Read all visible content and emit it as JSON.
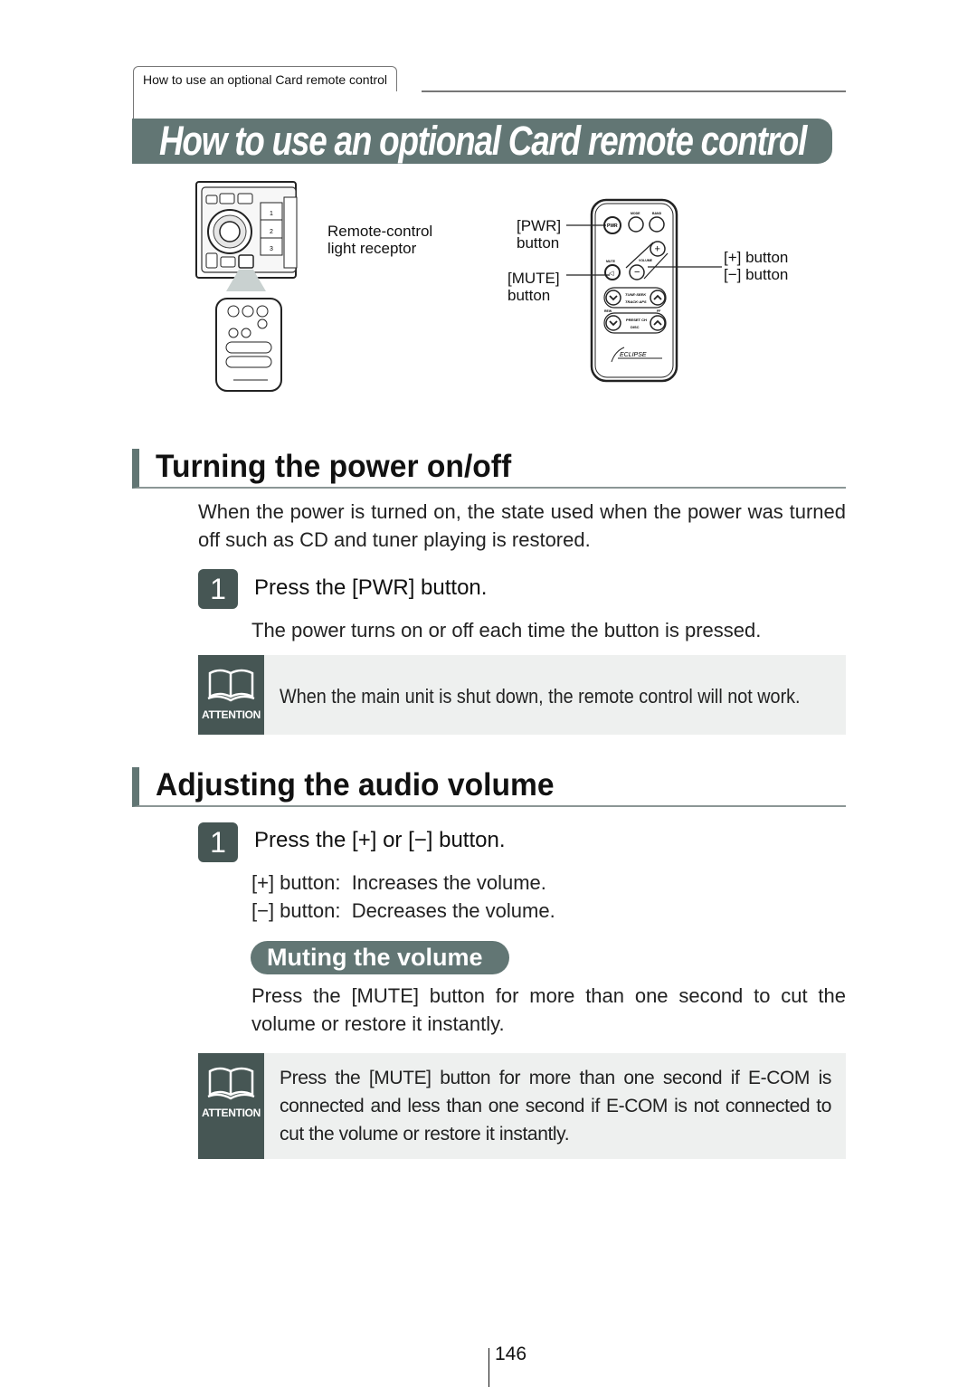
{
  "header": {
    "tab_label": "How to use an optional Card remote control",
    "banner_title": "How to use an optional Card remote control"
  },
  "diagram": {
    "receptor_label_line1": "Remote-control",
    "receptor_label_line2": "light receptor",
    "pwr_label_line1": "[PWR]",
    "pwr_label_line2": "button",
    "mute_label_line1": "[MUTE]",
    "mute_label_line2": "button",
    "plus_label": "[+] button",
    "minus_label": "[−] button",
    "remote_keys": {
      "pwr": "PWR",
      "mode": "MODE",
      "band": "BAND",
      "mute": "MUTE",
      "volume": "VOLUME",
      "tune_seek": "TUNE·SEEK",
      "track_aps": "TRACK·APS",
      "preset_ch": "PRESET CH",
      "disc": "DISC",
      "rew": "REW",
      "ff": "FF",
      "brand": "ECLIPSE"
    }
  },
  "section_power": {
    "title": "Turning the power on/off",
    "intro": "When the power is turned on, the state used when the power was turned off such as CD and tuner playing is restored.",
    "step_number": "1",
    "step_text": "Press the [PWR] button.",
    "step_detail": "The power turns on or off each time the button is pressed.",
    "attention_label": "ATTENTION",
    "attention_text": "When the main unit is shut down, the remote control will not work."
  },
  "section_volume": {
    "title": "Adjusting the audio volume",
    "step_number": "1",
    "step_text": "Press the [+] or [−] button.",
    "plus_desc": "[+] button:  Increases the volume.",
    "minus_desc": "[−] button:  Decreases the volume.",
    "mute_heading": "Muting the volume",
    "mute_text": "Press the [MUTE] button for more than one second to cut the volume or restore it instantly.",
    "attention_label": "ATTENTION",
    "attention_text": "Press the [MUTE] button for more than one second if E-COM is connected and less than one second if E-COM is not connected to cut the volume or restore it instantly."
  },
  "footer": {
    "page_number": "146"
  }
}
